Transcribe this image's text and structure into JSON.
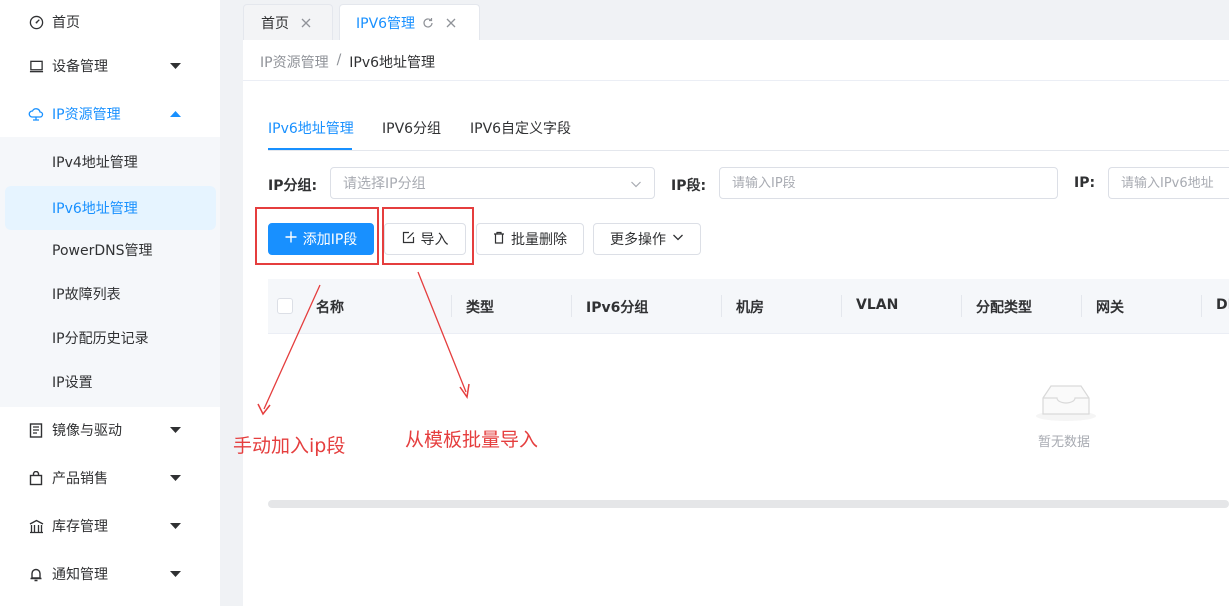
{
  "sidebar": {
    "items": [
      {
        "label": "首页",
        "icon": "dashboard-icon",
        "has_arrow": false
      },
      {
        "label": "设备管理",
        "icon": "monitor-icon",
        "has_arrow": true
      },
      {
        "label": "IP资源管理",
        "icon": "cloud-network-icon",
        "has_arrow": true,
        "expanded": true
      },
      {
        "label": "镜像与驱动",
        "icon": "image-drive-icon",
        "has_arrow": true
      },
      {
        "label": "产品销售",
        "icon": "shopping-bag-icon",
        "has_arrow": true
      },
      {
        "label": "库存管理",
        "icon": "warehouse-icon",
        "has_arrow": true
      },
      {
        "label": "通知管理",
        "icon": "bell-icon",
        "has_arrow": true
      }
    ],
    "subitems": [
      {
        "label": "IPv4地址管理"
      },
      {
        "label": "IPv6地址管理",
        "selected": true
      },
      {
        "label": "PowerDNS管理"
      },
      {
        "label": "IP故障列表"
      },
      {
        "label": "IP分配历史记录"
      },
      {
        "label": "IP设置"
      }
    ]
  },
  "tabs": [
    {
      "label": "首页",
      "active": false
    },
    {
      "label": "IPV6管理",
      "active": true
    }
  ],
  "breadcrumb": {
    "parent": "IP资源管理",
    "separator": "/",
    "current": "IPv6地址管理"
  },
  "inner_tabs": [
    {
      "label": "IPv6地址管理",
      "active": true
    },
    {
      "label": "IPV6分组",
      "active": false
    },
    {
      "label": "IPV6自定义字段",
      "active": false
    }
  ],
  "filters": {
    "group_label": "IP分组:",
    "group_placeholder": "请选择IP分组",
    "segment_label": "IP段:",
    "segment_placeholder": "请输入IP段",
    "ip_label": "IP:",
    "ip_placeholder": "请输入IPv6地址"
  },
  "toolbar": {
    "add_label": "添加IP段",
    "import_label": "导入",
    "batch_delete_label": "批量删除",
    "more_label": "更多操作"
  },
  "table": {
    "columns": [
      "名称",
      "类型",
      "IPv6分组",
      "机房",
      "VLAN",
      "分配类型",
      "网关",
      "DI"
    ],
    "empty_text": "暂无数据"
  },
  "annotations": {
    "add_note": "手动加入ip段",
    "import_note": "从模板批量导入"
  },
  "colors": {
    "accent": "#1890ff",
    "annotation": "#e53e3e",
    "sidebar_selected_bg": "#e6f4ff"
  }
}
